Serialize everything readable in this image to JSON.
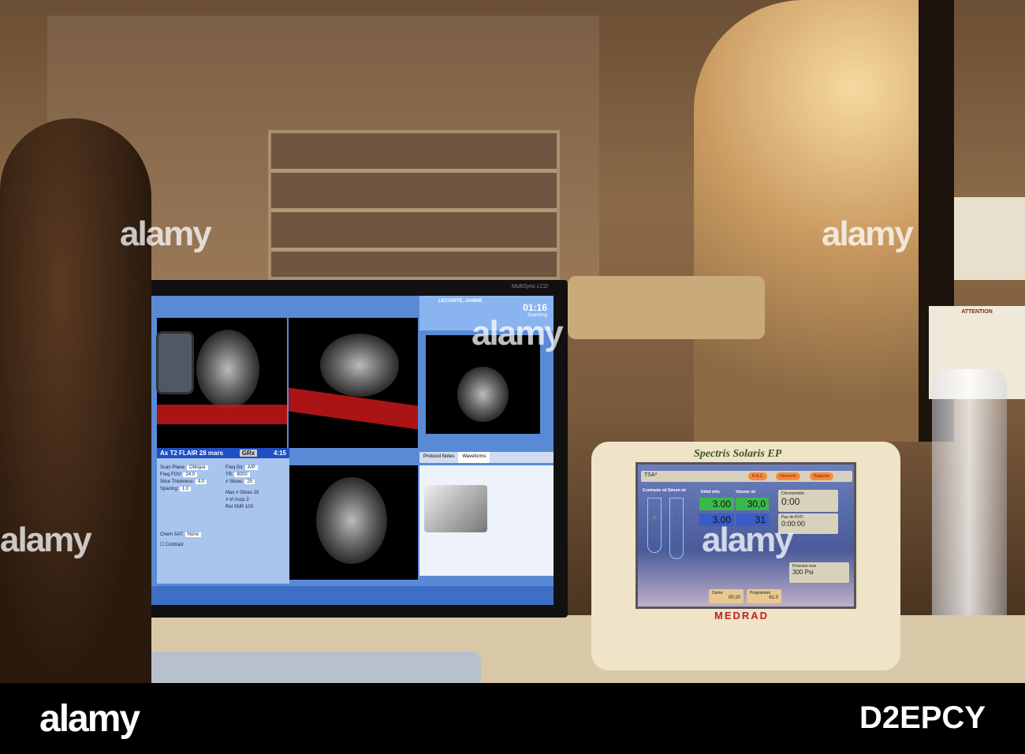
{
  "monitor": {
    "brand": "MultiSync LCD",
    "status": {
      "patient": "LECOINTE, JANINE",
      "time": "01:16",
      "state": "Scanning"
    },
    "control": {
      "title": "Ax T2 FLAIR 28 mars",
      "mode": "GRx",
      "duration": "4:15",
      "fields": [
        {
          "label": "Scan Plane",
          "value": "Oblique"
        },
        {
          "label": "Freq FOV",
          "value": "24.0"
        },
        {
          "label": "Slice Thickness",
          "value": "4.0"
        },
        {
          "label": "Spacing",
          "value": "1.0"
        }
      ],
      "right_fields": [
        {
          "label": "Freq Dir",
          "value": "A/P"
        },
        {
          "label": "TR",
          "value": "8000"
        },
        {
          "label": "# Slices",
          "value": "25"
        }
      ],
      "stats": [
        {
          "label": "Max # Slices",
          "value": "18"
        },
        {
          "label": "# of Acqs",
          "value": "2"
        },
        {
          "label": "Rel SNR",
          "value": "100"
        }
      ],
      "chem_sat_label": "Chem SAT",
      "chem_sat_value": "None",
      "contrast_label": "Contrast"
    },
    "tabs": [
      "Protocol Notes",
      "Waveforms"
    ]
  },
  "injector": {
    "brand": "Spectris Solaris EP",
    "maker": "MEDRAD",
    "protocol": "TSA*",
    "buttons": [
      "R.A.Z.",
      "Démarrer",
      "Rappeler"
    ],
    "col_labels": {
      "contrast": "Contraste ml",
      "serum": "Sérum ml",
      "rate": "Débit ml/s",
      "volume": "Volume ml"
    },
    "syringes": [
      "A",
      "B"
    ],
    "phases": [
      {
        "rate": "3.00",
        "volume": "30,0"
      },
      {
        "rate": "3.00",
        "volume": "31"
      }
    ],
    "chrono": {
      "label": "Chronomètre",
      "value": "0:00"
    },
    "kvo": {
      "label": "Pas de KVO",
      "value": "0:00:00"
    },
    "pressure": {
      "label": "Pression max",
      "value": "300 Psi"
    },
    "bottom": [
      {
        "label": "Durée",
        "value": "00:20"
      },
      {
        "label": "Programmé",
        "value": "61.0"
      }
    ]
  },
  "watermark": "alamy",
  "footer": {
    "logo": "alamy",
    "image_id": "D2EPCY"
  },
  "notice": {
    "title": "ATTENTION"
  }
}
